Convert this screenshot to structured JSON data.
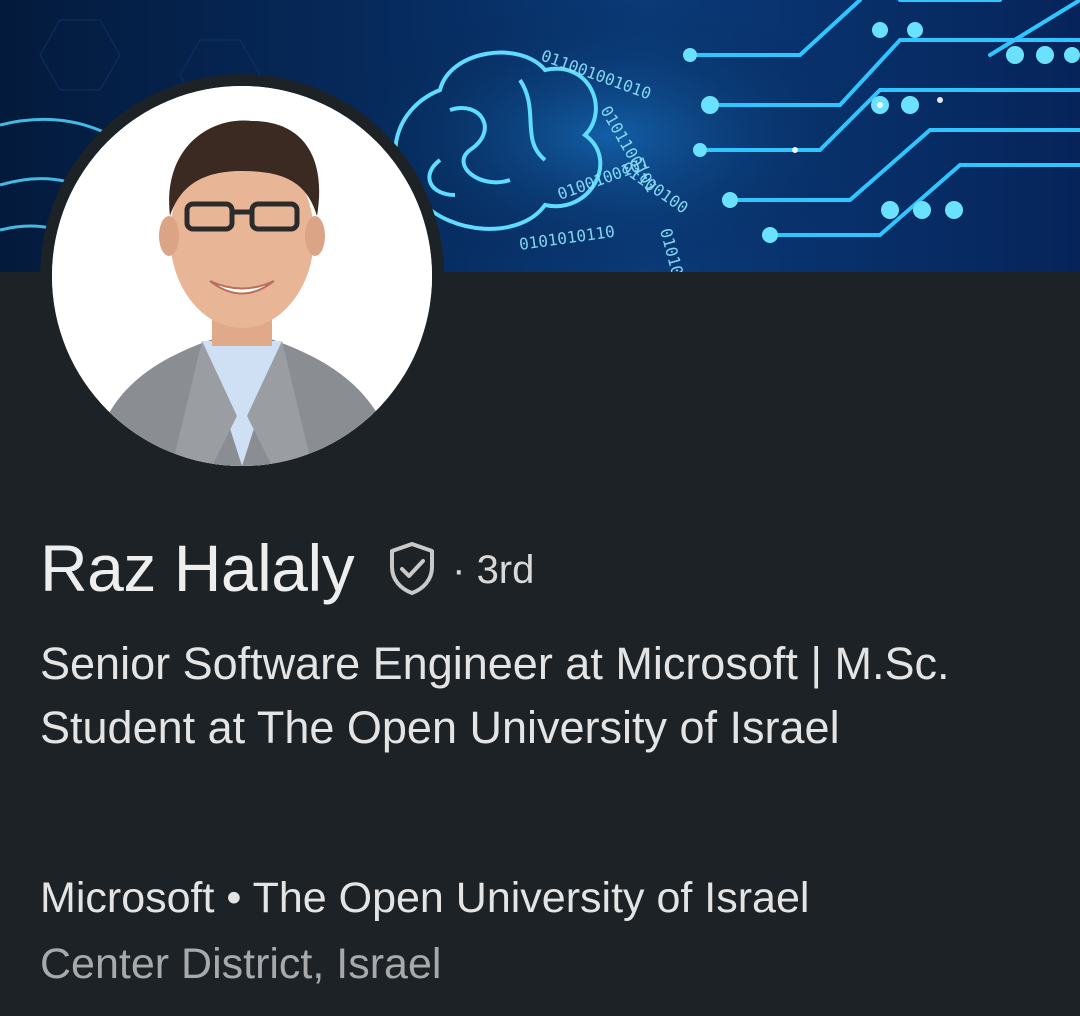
{
  "profile": {
    "name": "Raz Halaly",
    "verified_icon": "shield-check-icon",
    "degree_prefix": "·",
    "degree": "3rd",
    "headline": "Senior Software Engineer at Microsoft | M.Sc. Student at The Open University of Israel",
    "organizations": "Microsoft • The Open University of Israel",
    "location": "Center District, Israel"
  },
  "banner": {
    "theme": "circuit-brain-binary",
    "binary_text": "0101100101001010101100101"
  },
  "colors": {
    "background": "#1d2226",
    "text_primary": "#eeeeee",
    "text_secondary": "#a7a9ab",
    "banner_glow": "#3fd3ff"
  }
}
